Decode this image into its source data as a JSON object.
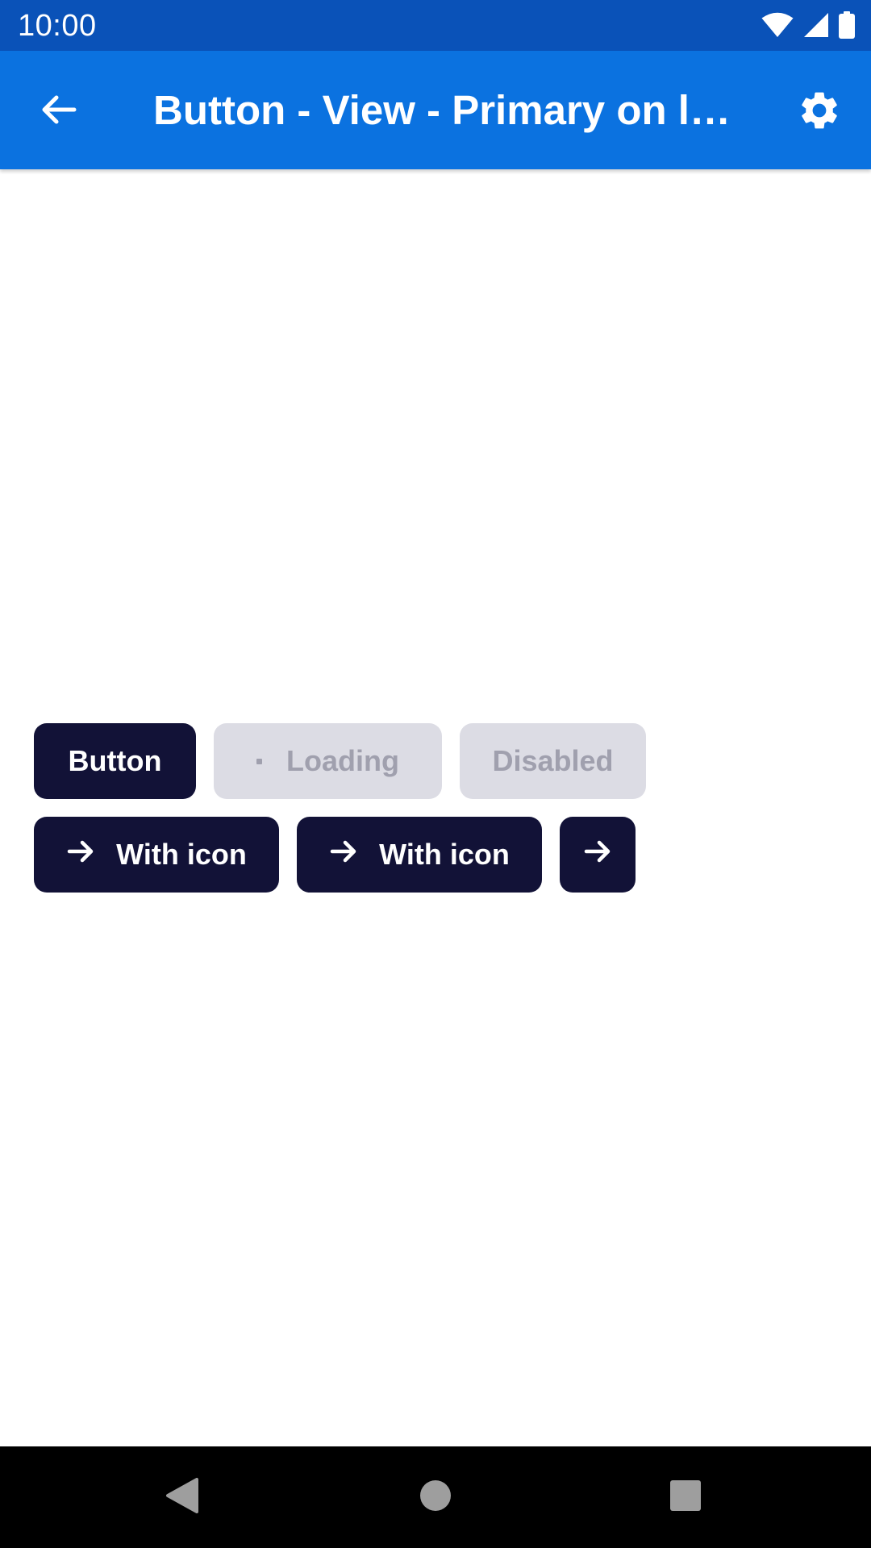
{
  "status_bar": {
    "time": "10:00",
    "icons": [
      "wifi-icon",
      "cell-signal-icon",
      "battery-icon"
    ]
  },
  "app_bar": {
    "title": "Button - View - Primary on light",
    "back_icon": "arrow-back-icon",
    "settings_icon": "gear-icon"
  },
  "buttons": {
    "row1": [
      {
        "label": "Button",
        "state": "enabled"
      },
      {
        "label": "Loading",
        "state": "loading"
      },
      {
        "label": "Disabled",
        "state": "disabled"
      }
    ],
    "row2": [
      {
        "label": "With icon",
        "icon": "arrow-right-icon"
      },
      {
        "label": "With icon",
        "icon": "arrow-right-icon"
      },
      {
        "label": "",
        "icon": "arrow-right-icon"
      }
    ]
  },
  "nav_bar": {
    "buttons": [
      "nav-back-icon",
      "nav-home-icon",
      "nav-recents-icon"
    ]
  },
  "colors": {
    "status_bar": "#0a52b8",
    "app_bar": "#0b72e0",
    "primary_button": "#121237",
    "muted_button": "#dcdce4",
    "muted_text": "#a0a0ae"
  }
}
